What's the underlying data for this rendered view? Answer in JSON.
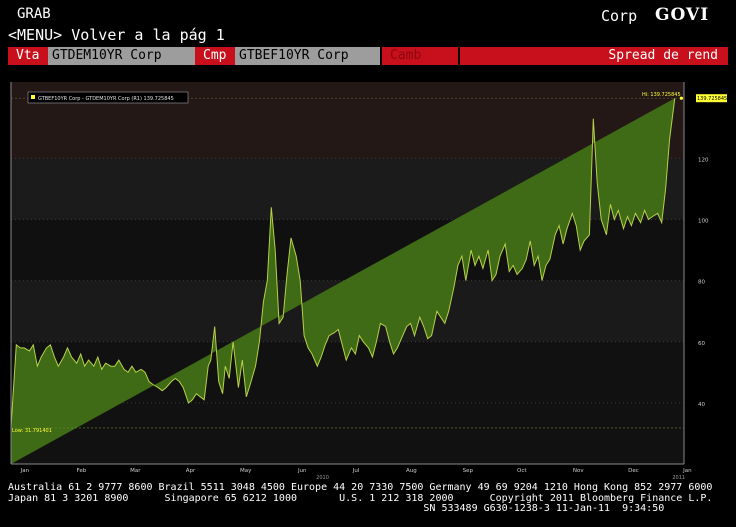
{
  "header": {
    "grab": "GRAB",
    "menu_link": "<MENU> Volver a la pág 1",
    "sector": "Corp",
    "function": "GOVI"
  },
  "fields": {
    "vta_label": "Vta",
    "vta_value": "GTDEM10YR Corp",
    "cmp_label": "Cmp",
    "cmp_value": "GTBEF10YR Corp",
    "camb_label": "Camb",
    "mode_label": "Spread de rend"
  },
  "chart_data": {
    "type": "area",
    "legend": "GTBEF10YR Corp - GTDEM10YR Corp (R1) 139.725845",
    "hi_label": "Hi: 139.725845",
    "last_value_label": "139.725845",
    "low_label": "Low: 31.791401",
    "year_label": "2010",
    "year_label_end": "2011",
    "ylim": [
      20,
      145
    ],
    "y_ticks": [
      40,
      60,
      80,
      100,
      120
    ],
    "months": [
      "Jan",
      "Feb",
      "Mar",
      "Apr",
      "May",
      "Jun",
      "Jul",
      "Aug",
      "Sep",
      "Oct",
      "Nov",
      "Dec",
      "Jan"
    ],
    "month_pos": [
      0.6,
      4.9,
      9.0,
      13.2,
      17.4,
      21.7,
      25.8,
      30.0,
      34.3,
      38.4,
      42.7,
      46.9,
      51.0
    ],
    "x": [
      0.0,
      0.4,
      0.7,
      1.0,
      1.4,
      1.7,
      2.0,
      2.3,
      2.7,
      3.0,
      3.3,
      3.6,
      4.0,
      4.3,
      4.6,
      5.0,
      5.3,
      5.6,
      5.9,
      6.3,
      6.6,
      6.9,
      7.2,
      7.6,
      7.9,
      8.2,
      8.6,
      8.9,
      9.2,
      9.5,
      9.9,
      10.2,
      10.5,
      10.8,
      11.2,
      11.5,
      11.8,
      12.2,
      12.5,
      12.8,
      13.1,
      13.5,
      13.8,
      14.1,
      14.4,
      14.7,
      15.0,
      15.2,
      15.5,
      15.8,
      16.1,
      16.3,
      16.6,
      16.9,
      17.3,
      17.6,
      17.9,
      18.2,
      18.6,
      18.9,
      19.2,
      19.5,
      19.8,
      20.1,
      20.4,
      20.7,
      21.0,
      21.3,
      21.7,
      22.0,
      22.3,
      22.6,
      22.9,
      23.3,
      23.6,
      23.9,
      24.2,
      24.6,
      24.9,
      25.2,
      25.5,
      25.9,
      26.2,
      26.5,
      26.8,
      27.2,
      27.5,
      27.8,
      28.1,
      28.5,
      28.8,
      29.1,
      29.4,
      29.8,
      30.1,
      30.4,
      30.7,
      31.1,
      31.4,
      31.7,
      32.0,
      32.4,
      32.7,
      33.0,
      33.3,
      33.7,
      34.0,
      34.3,
      34.6,
      35.0,
      35.3,
      35.6,
      35.9,
      36.3,
      36.6,
      36.9,
      37.2,
      37.6,
      37.9,
      38.2,
      38.5,
      38.9,
      39.2,
      39.5,
      39.8,
      40.1,
      40.4,
      40.7,
      41.0,
      41.4,
      41.7,
      42.0,
      42.3,
      42.7,
      43.0,
      43.3,
      43.6,
      44.0,
      44.3,
      44.6,
      44.9,
      45.3,
      45.6,
      45.9,
      46.2,
      46.6,
      46.9,
      47.2,
      47.5,
      47.9,
      48.2,
      48.5,
      48.8,
      49.2,
      49.5,
      49.8,
      50.1,
      50.5,
      50.8,
      51.0
    ],
    "values": [
      32,
      59,
      58,
      58,
      57,
      59,
      52,
      55,
      58,
      59,
      55,
      52,
      55,
      58,
      55,
      53,
      56,
      52,
      54,
      52,
      55,
      51,
      53,
      52,
      52,
      54,
      51,
      50,
      52,
      50,
      51,
      50,
      47,
      46,
      45,
      44,
      45,
      47,
      48,
      47,
      45,
      40,
      41,
      43,
      42,
      41,
      52,
      54,
      65,
      47,
      43,
      52,
      48,
      60,
      45,
      54,
      42,
      46,
      52,
      60,
      73,
      80,
      104,
      90,
      66,
      68,
      82,
      94,
      88,
      80,
      62,
      58,
      56,
      52,
      55,
      59,
      62,
      63,
      64,
      59,
      54,
      58,
      56,
      62,
      60,
      58,
      55,
      60,
      66,
      65,
      60,
      56,
      58,
      62,
      65,
      66,
      62,
      68,
      65,
      61,
      62,
      70,
      68,
      66,
      70,
      78,
      85,
      88,
      80,
      90,
      85,
      88,
      84,
      90,
      80,
      82,
      88,
      92,
      83,
      85,
      82,
      84,
      87,
      93,
      85,
      88,
      80,
      85,
      87,
      95,
      98,
      92,
      97,
      102,
      98,
      90,
      93,
      95,
      133,
      112,
      100,
      95,
      105,
      100,
      103,
      97,
      101,
      98,
      102,
      99,
      103,
      100,
      101,
      102,
      99,
      110,
      126,
      139.7
    ]
  },
  "footer": {
    "line1": "Australia 61 2 9777 8600 Brazil 5511 3048 4500 Europe 44 20 7330 7500 Germany 49 69 9204 1210 Hong Kong 852 2977 6000",
    "line2": "Japan 81 3 3201 8900      Singapore 65 6212 1000       U.S. 1 212 318 2000      Copyright 2011 Bloomberg Finance L.P.",
    "line3": "                                                                     SN 533489 G630-1238-3 11-Jan-11  9:34:50"
  }
}
